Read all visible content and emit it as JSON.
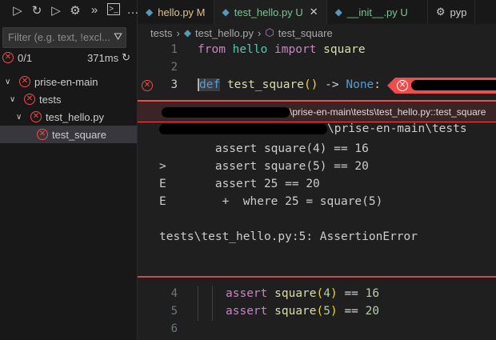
{
  "toolbar": {
    "icons": [
      "run-tests",
      "refresh",
      "run-all",
      "debug-tests",
      "run-coverage",
      "terminal",
      "more"
    ]
  },
  "filter": {
    "placeholder": "Filter (e.g. text, !excl..."
  },
  "summary": {
    "count": "0/1",
    "duration": "371ms"
  },
  "tree": [
    {
      "label": "prise-en-main",
      "depth": 0
    },
    {
      "label": "tests",
      "depth": 1
    },
    {
      "label": "test_hello.py",
      "depth": 2
    },
    {
      "label": "test_square",
      "depth": 3,
      "selected": true
    }
  ],
  "tabs": [
    {
      "label": "hello.py",
      "badge": "M"
    },
    {
      "label": "test_hello.py",
      "badge": "U"
    },
    {
      "label": "__init__.py",
      "badge": "U"
    },
    {
      "label": "pyp"
    }
  ],
  "breadcrumb": [
    "tests",
    "test_hello.py",
    "test_square"
  ],
  "editor": {
    "line1": {
      "n": "1",
      "from": "from",
      "mod": "hello",
      "imp": "import",
      "name": "square"
    },
    "line2": {
      "n": "2"
    },
    "line3": {
      "n": "3",
      "def": "def",
      "fn": "test_square",
      "paren": "()",
      "arrow": " -> ",
      "none": "None",
      ":": ":"
    }
  },
  "peek": {
    "header": "\\prise-en-main\\tests\\test_hello.py::test_square",
    "path": "\\prise-en-main\\tests",
    "lines": [
      "        assert square(4) == 16",
      ">       assert square(5) == 20",
      "E       assert 25 == 20",
      "E        +  where 25 = square(5)",
      "",
      "tests\\test_hello.py:5: AssertionError"
    ]
  },
  "bottom": [
    {
      "n": "4",
      "kw": "assert",
      "fn": "square",
      "arg": "4",
      "rest": " == ",
      "num": "16"
    },
    {
      "n": "5",
      "kw": "assert",
      "fn": "square",
      "arg": "5",
      "rest": " == ",
      "num": "20"
    },
    {
      "n": "6"
    }
  ]
}
